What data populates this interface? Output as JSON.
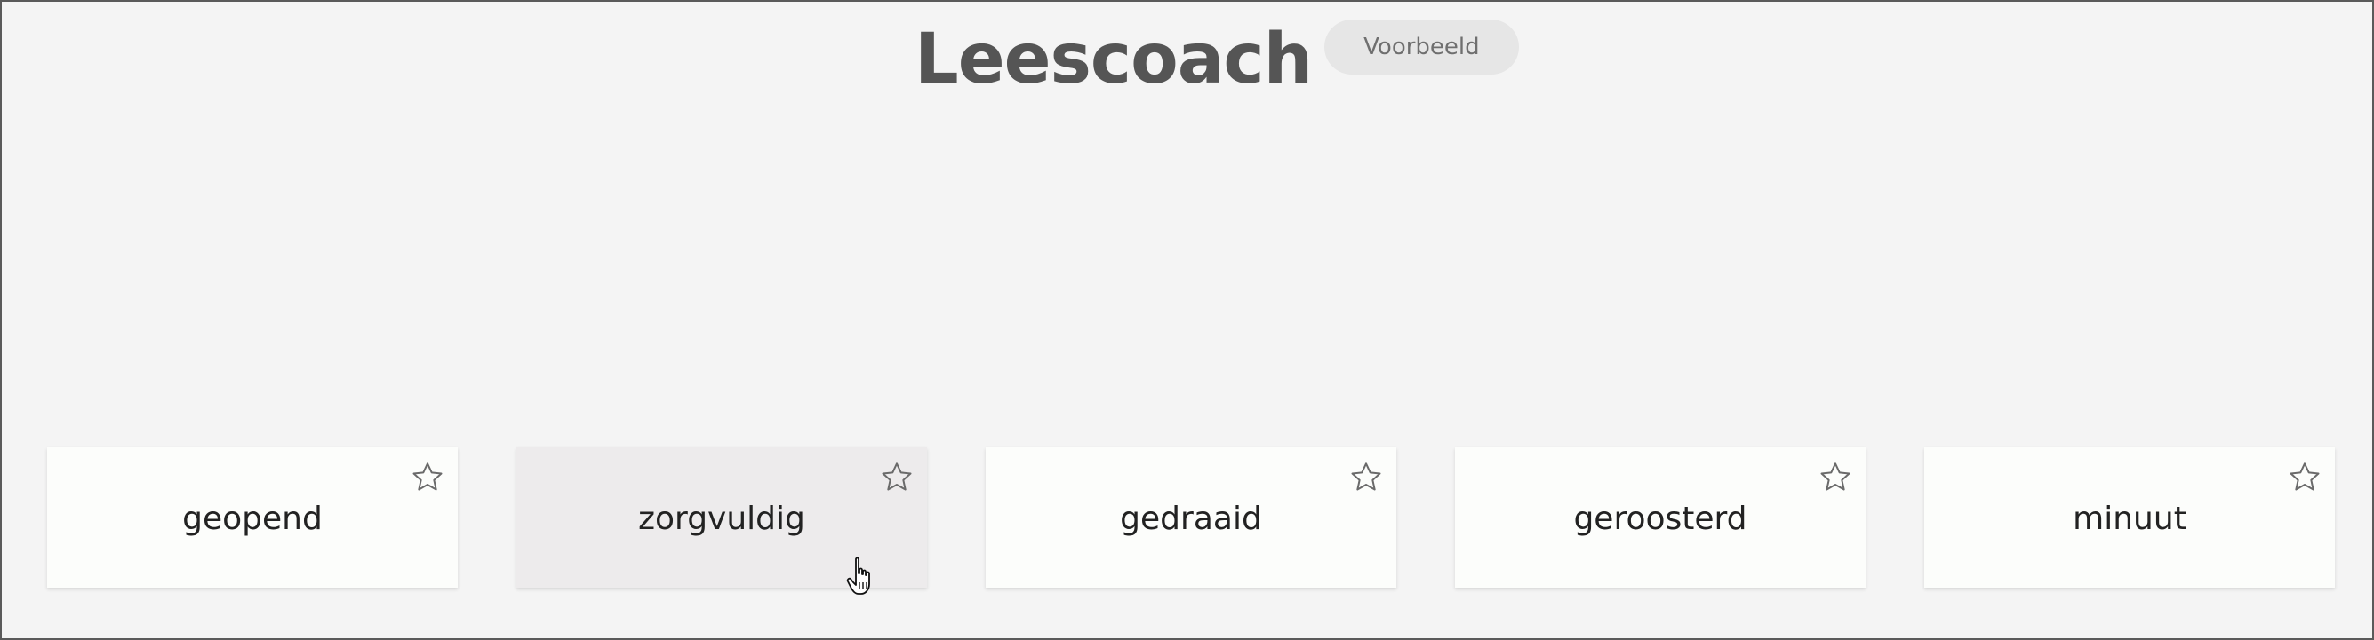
{
  "header": {
    "title": "Leescoach",
    "badge": "Voorbeeld"
  },
  "cards": [
    {
      "word": "geopend"
    },
    {
      "word": "zorgvuldig"
    },
    {
      "word": "gedraaid"
    },
    {
      "word": "geroosterd"
    },
    {
      "word": "minuut"
    }
  ],
  "icons": {
    "star": "star-outline-icon",
    "cursor": "hand-pointer-icon"
  },
  "colors": {
    "background": "#f4f4f4",
    "card": "#fcfdfb",
    "card_hover": "#edebec",
    "title": "#555555"
  }
}
